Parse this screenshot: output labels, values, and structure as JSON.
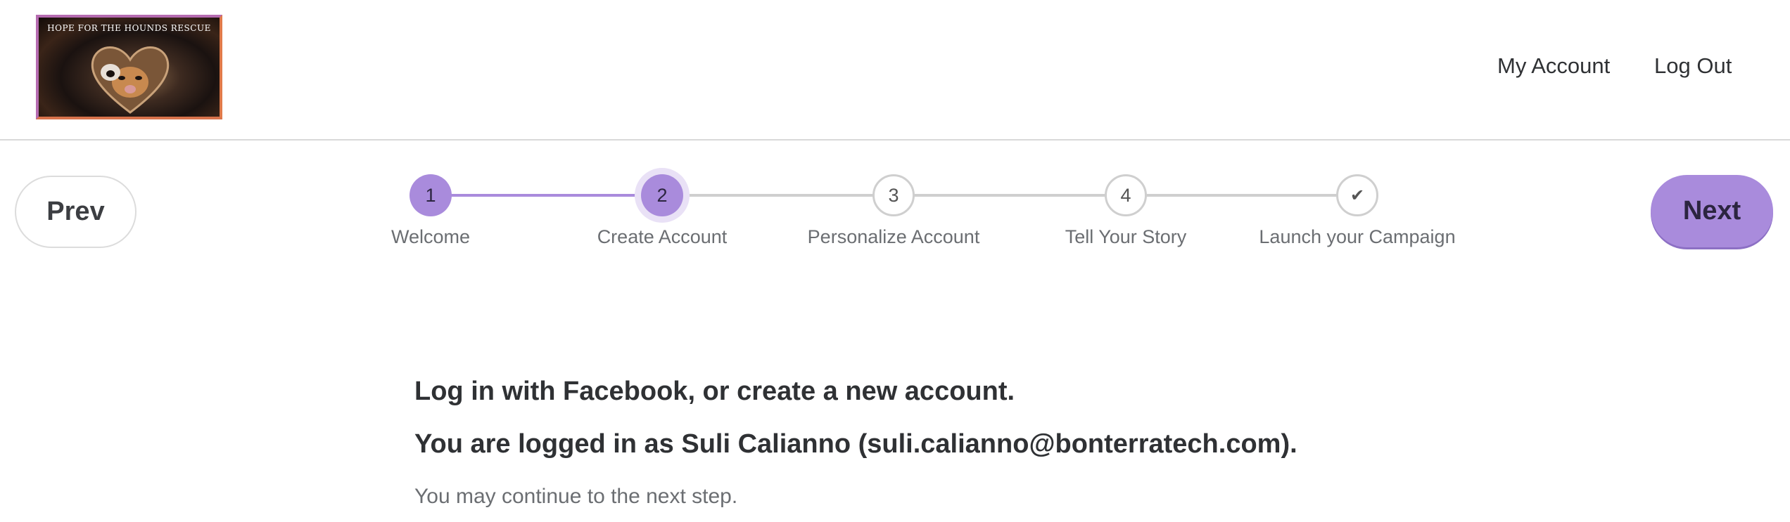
{
  "header": {
    "logo_text": "HOPE FOR THE HOUNDS RESCUE",
    "nav": {
      "my_account": "My Account",
      "log_out": "Log Out"
    }
  },
  "navigation": {
    "prev_label": "Prev",
    "next_label": "Next"
  },
  "stepper": {
    "steps": [
      {
        "number": "1",
        "label": "Welcome",
        "state": "complete"
      },
      {
        "number": "2",
        "label": "Create Account",
        "state": "current"
      },
      {
        "number": "3",
        "label": "Personalize Account",
        "state": "pending"
      },
      {
        "number": "4",
        "label": "Tell Your Story",
        "state": "pending"
      },
      {
        "number": "✔",
        "label": "Launch your Campaign",
        "state": "pending",
        "icon": "check-icon"
      }
    ]
  },
  "main": {
    "heading": "Log in with Facebook, or create a new account.",
    "logged_in_text": "You are logged in as Suli Calianno (suli.calianno@bonterratech.com).",
    "continue_text": "You may continue to the next step."
  },
  "colors": {
    "accent": "#a98bdc",
    "accent_light": "#e9e1f6",
    "line_inactive": "#cfcfcf",
    "text_dark": "#2f3134",
    "text_muted": "#6b6e72"
  }
}
